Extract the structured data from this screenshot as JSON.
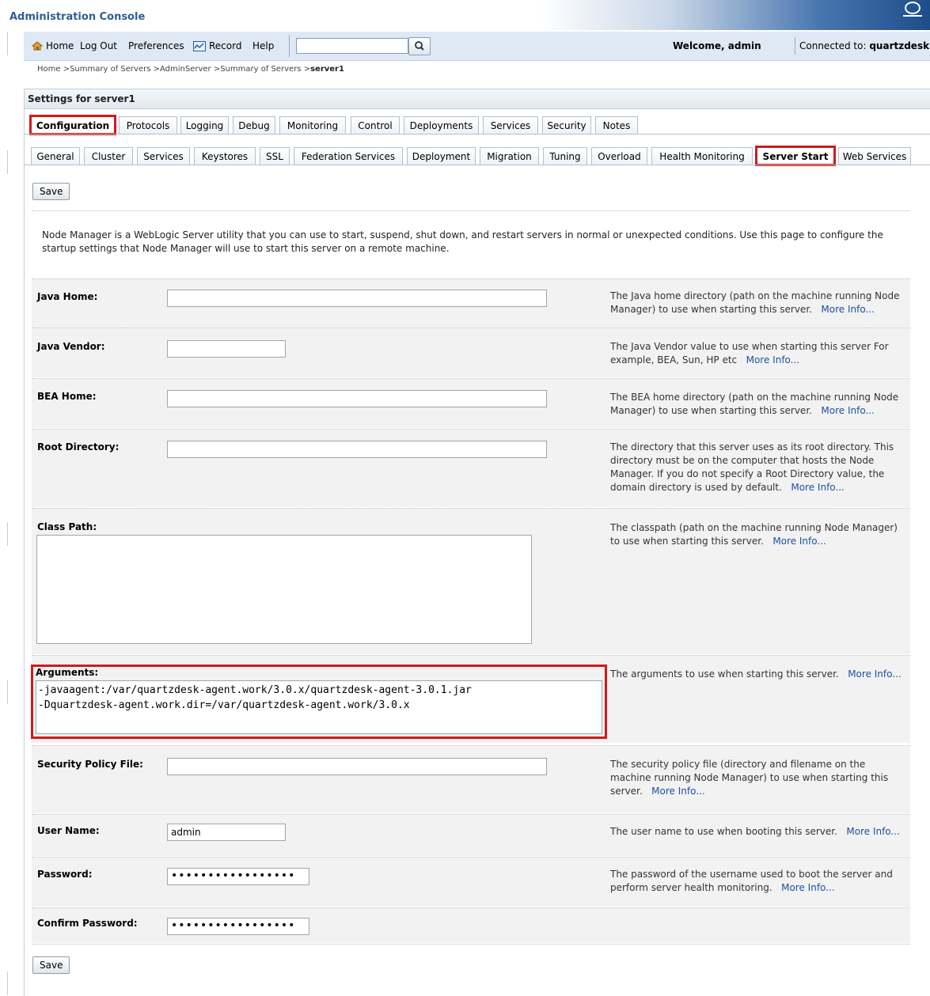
{
  "app": {
    "title": "Administration Console"
  },
  "toolbar": {
    "home": "Home",
    "logout": "Log Out",
    "preferences": "Preferences",
    "record": "Record",
    "help": "Help",
    "search_value": "",
    "welcome_prefix": "Welcome, ",
    "welcome_user": "admin",
    "connected_prefix": "Connected to: ",
    "connected_domain": "quartzdesk"
  },
  "breadcrumb": {
    "trail": "Home >Summary of Servers >AdminServer >Summary of Servers >",
    "current": "server1"
  },
  "settings_title": "Settings for server1",
  "primary_tabs": [
    "Configuration",
    "Protocols",
    "Logging",
    "Debug",
    "Monitoring",
    "Control",
    "Deployments",
    "Services",
    "Security",
    "Notes"
  ],
  "secondary_tabs": [
    "General",
    "Cluster",
    "Services",
    "Keystores",
    "SSL",
    "Federation Services",
    "Deployment",
    "Migration",
    "Tuning",
    "Overload",
    "Health Monitoring",
    "Server Start",
    "Web Services"
  ],
  "save_label": "Save",
  "intro": "Node Manager is a WebLogic Server utility that you can use to start, suspend, shut down, and restart servers in normal or unexpected conditions. Use this page to configure the startup settings that Node Manager will use to start this server on a remote machine.",
  "more_info": "More Info...",
  "fields": {
    "java_home": {
      "label": "Java Home:",
      "value": "",
      "desc": "The Java home directory (path on the machine running Node Manager) to use when starting this server."
    },
    "java_vendor": {
      "label": "Java Vendor:",
      "value": "",
      "desc": "The Java Vendor value to use when starting this server For example, BEA, Sun, HP etc"
    },
    "bea_home": {
      "label": "BEA Home:",
      "value": "",
      "desc": "The BEA home directory (path on the machine running Node Manager) to use when starting this server."
    },
    "root_directory": {
      "label": "Root Directory:",
      "value": "",
      "desc": "The directory that this server uses as its root directory. This directory must be on the computer that hosts the Node Manager. If you do not specify a Root Directory value, the domain directory is used by default."
    },
    "class_path": {
      "label": "Class Path:",
      "value": "",
      "desc": "The classpath (path on the machine running Node Manager) to use when starting this server."
    },
    "arguments": {
      "label": "Arguments:",
      "value": "-javaagent:/var/quartzdesk-agent.work/3.0.x/quartzdesk-agent-3.0.1.jar\n-Dquartzdesk-agent.work.dir=/var/quartzdesk-agent.work/3.0.x",
      "desc": "The arguments to use when starting this server."
    },
    "security_policy": {
      "label": "Security Policy File:",
      "value": "",
      "desc": "The security policy file (directory and filename on the machine running Node Manager) to use when starting this server."
    },
    "user_name": {
      "label": "User Name:",
      "value": "admin",
      "desc": "The user name to use when booting this server."
    },
    "password": {
      "label": "Password:",
      "value": "•••••••••••••••••",
      "desc": "The password of the username used to boot the server and perform server health monitoring."
    },
    "confirm_password": {
      "label": "Confirm Password:",
      "value": "•••••••••••••••••"
    }
  }
}
